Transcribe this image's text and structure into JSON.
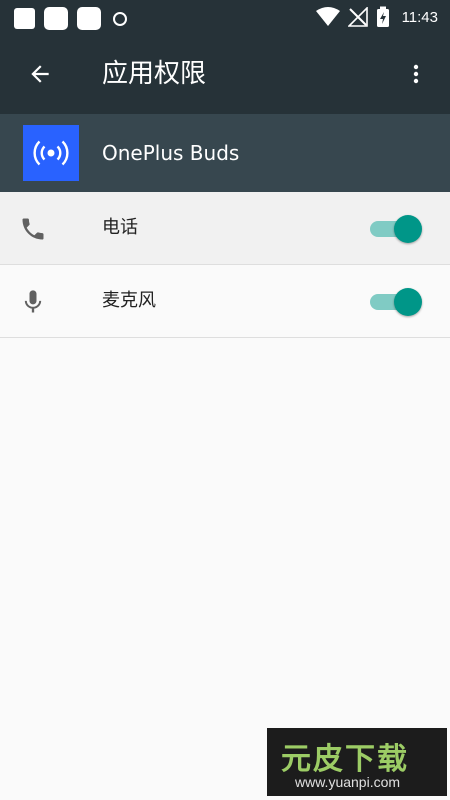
{
  "status_bar": {
    "time": "11:43",
    "icons": [
      "notification-square-icon",
      "notification-rounded-icon",
      "notification-rounded-icon",
      "shield-icon",
      "wifi-icon",
      "no-signal-icon",
      "battery-charging-icon"
    ]
  },
  "toolbar": {
    "title": "应用权限",
    "back_icon": "arrow-left-icon",
    "menu_icon": "more-vert-icon"
  },
  "app": {
    "name": "OnePlus Buds",
    "icon": "broadcast-icon",
    "icon_color": "#2962ff"
  },
  "permissions": [
    {
      "label": "电话",
      "icon": "phone-icon",
      "enabled": true
    },
    {
      "label": "麦克风",
      "icon": "mic-icon",
      "enabled": true
    }
  ],
  "watermark": {
    "brand": "元皮下载",
    "url": "www.yuanpi.com"
  },
  "colors": {
    "toolbar": "#263238",
    "app_header": "#37474f",
    "accent": "#009688",
    "accent_track": "#80cbc4"
  }
}
